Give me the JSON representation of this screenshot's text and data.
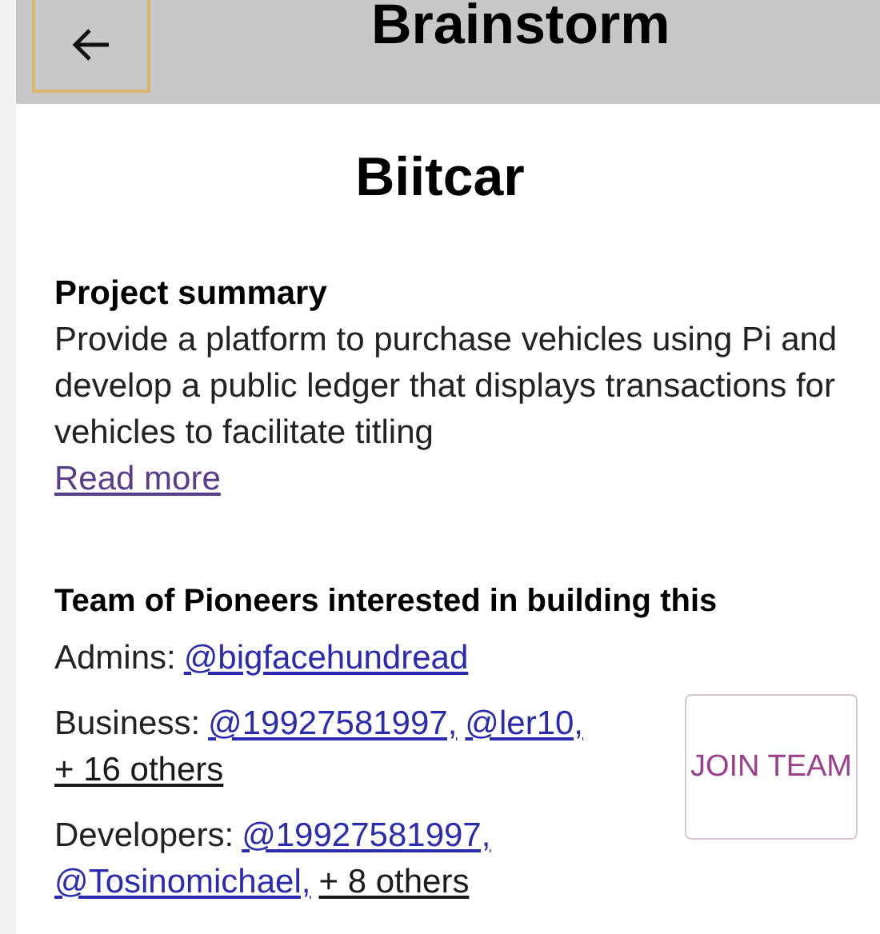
{
  "header": {
    "title": "Brainstorm"
  },
  "project": {
    "name": "Biitcar"
  },
  "summary": {
    "heading": "Project summary",
    "text": "Provide a platform to purchase vehicles using Pi and develop a public ledger that displays transactions for vehicles to facilitate titling",
    "link": "Read more"
  },
  "team": {
    "heading": "Team of Pioneers interested in building this",
    "roles": [
      {
        "label": "Admins:",
        "members": [
          {
            "kind": "user",
            "text": "@bigfacehundread"
          }
        ]
      },
      {
        "label": "Business:",
        "members": [
          {
            "kind": "user",
            "text": "@19927581997,"
          },
          {
            "kind": "user",
            "text": "@ler10,"
          },
          {
            "kind": "others",
            "text": "+ 16 others"
          }
        ]
      },
      {
        "label": "Developers:",
        "members": [
          {
            "kind": "user",
            "text": "@19927581997,"
          },
          {
            "kind": "user",
            "text": "@Tosinomichael,"
          },
          {
            "kind": "others",
            "text": "+ 8 others"
          }
        ]
      }
    ],
    "join_button": "JOIN TEAM"
  }
}
